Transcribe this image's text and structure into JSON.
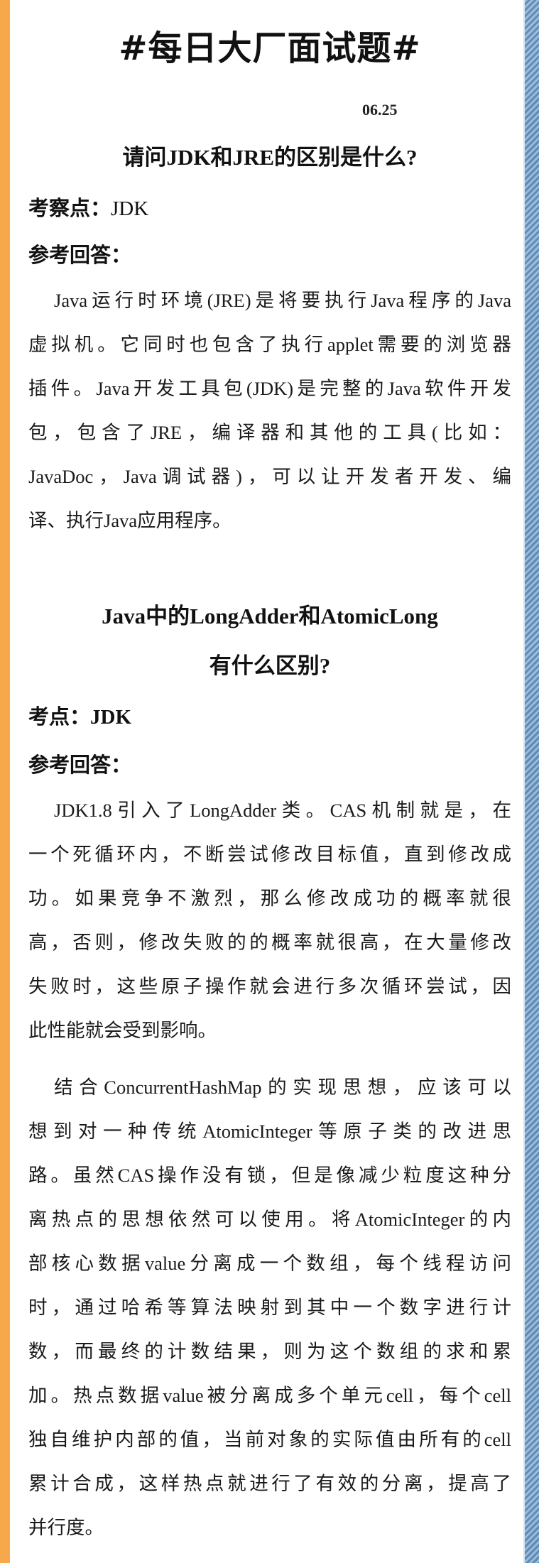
{
  "header": {
    "title": "#每日大厂面试题#",
    "date": "06.25"
  },
  "q1": {
    "title": "请问JDK和JRE的区别是什么?",
    "point_label": "考察点：",
    "point_value": "JDK",
    "answer_label": "参考回答：",
    "answer_lines": [
      "Java运行时环境(JRE)是将要执行Java程序的Java",
      "虚拟机。它同时也包含了执行applet需要的浏览器",
      "插件。Java开发工具包(JDK)是完整的Java软件开发",
      "包，包含了JRE，编译器和其他的工具(比如：",
      "JavaDoc，Java调试器)，可以让开发者开发、编",
      "译、执行Java应用程序。"
    ]
  },
  "q2": {
    "title_line1": "Java中的LongAdder和AtomicLong",
    "title_line2": "有什么区别?",
    "point_label": "考点：",
    "point_value": "JDK",
    "answer_label": "参考回答：",
    "para1_lines": [
      "JDK1.8引入了LongAdder类。CAS机制就是，在",
      "一个死循环内，不断尝试修改目标值，直到修改成",
      "功。如果竞争不激烈，那么修改成功的概率就很",
      "高，否则，修改失败的的概率就很高，在大量修改",
      "失败时，这些原子操作就会进行多次循环尝试，因",
      "此性能就会受到影响。"
    ],
    "para2_lines": [
      "结合ConcurrentHashMap的实现思想，应该可以",
      "想到对一种传统AtomicInteger等原子类的改进思",
      "路。虽然CAS操作没有锁，但是像减少粒度这种分",
      "离热点的思想依然可以使用。将AtomicInteger的内",
      "部核心数据value分离成一个数组，每个线程访问",
      "时，通过哈希等算法映射到其中一个数字进行计",
      "数，而最终的计数结果，则为这个数组的求和累",
      "加。热点数据value被分离成多个单元cell，每个cell",
      "独自维护内部的值，当前对象的实际值由所有的cell",
      "累计合成，这样热点就进行了有效的分离，提高了",
      "并行度。"
    ]
  },
  "colors": {
    "left_bar": "#f7a84a",
    "right_bar": "#6f9bc3",
    "text": "#1a1a1a"
  }
}
